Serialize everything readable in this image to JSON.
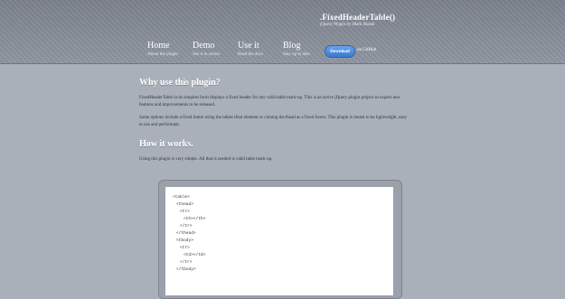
{
  "header": {
    "title": ".FixedHeaderTable()",
    "subtitle": "jQuery Plugin by Mark Malek",
    "nav": [
      {
        "label": "Home",
        "desc": "About the plugin"
      },
      {
        "label": "Demo",
        "desc": "See it in action"
      },
      {
        "label": "Use it",
        "desc": "Read the docs"
      },
      {
        "label": "Blog",
        "desc": "Stay up to date"
      }
    ],
    "download_label": "Download",
    "github_label": "on GitHub"
  },
  "sections": {
    "why_title": "Why use this plugin?",
    "why_p1": "FixedHeaderTable in its simplest form displays a fixed header for any valid table mark-up. This is an active jQuery plugin project so expect new features and improvements to be released.",
    "why_p2": "Some options include a fixed footer using the tables tfoot element or cloning the thead as a fixed footer. This plugin is meant to be lightweight, easy to use and performant.",
    "how_title": "How it works.",
    "how_p1": "Using this plugin is very simple. All that is needed is valid table mark-up."
  },
  "code": {
    "lines": [
      "<table>",
      "<thead>",
      "<tr>",
      "<th></th>",
      "</tr>",
      "</thead>",
      "<tbody>",
      "<tr>",
      "<td></td>",
      "</tr>",
      "</tbody>"
    ]
  }
}
